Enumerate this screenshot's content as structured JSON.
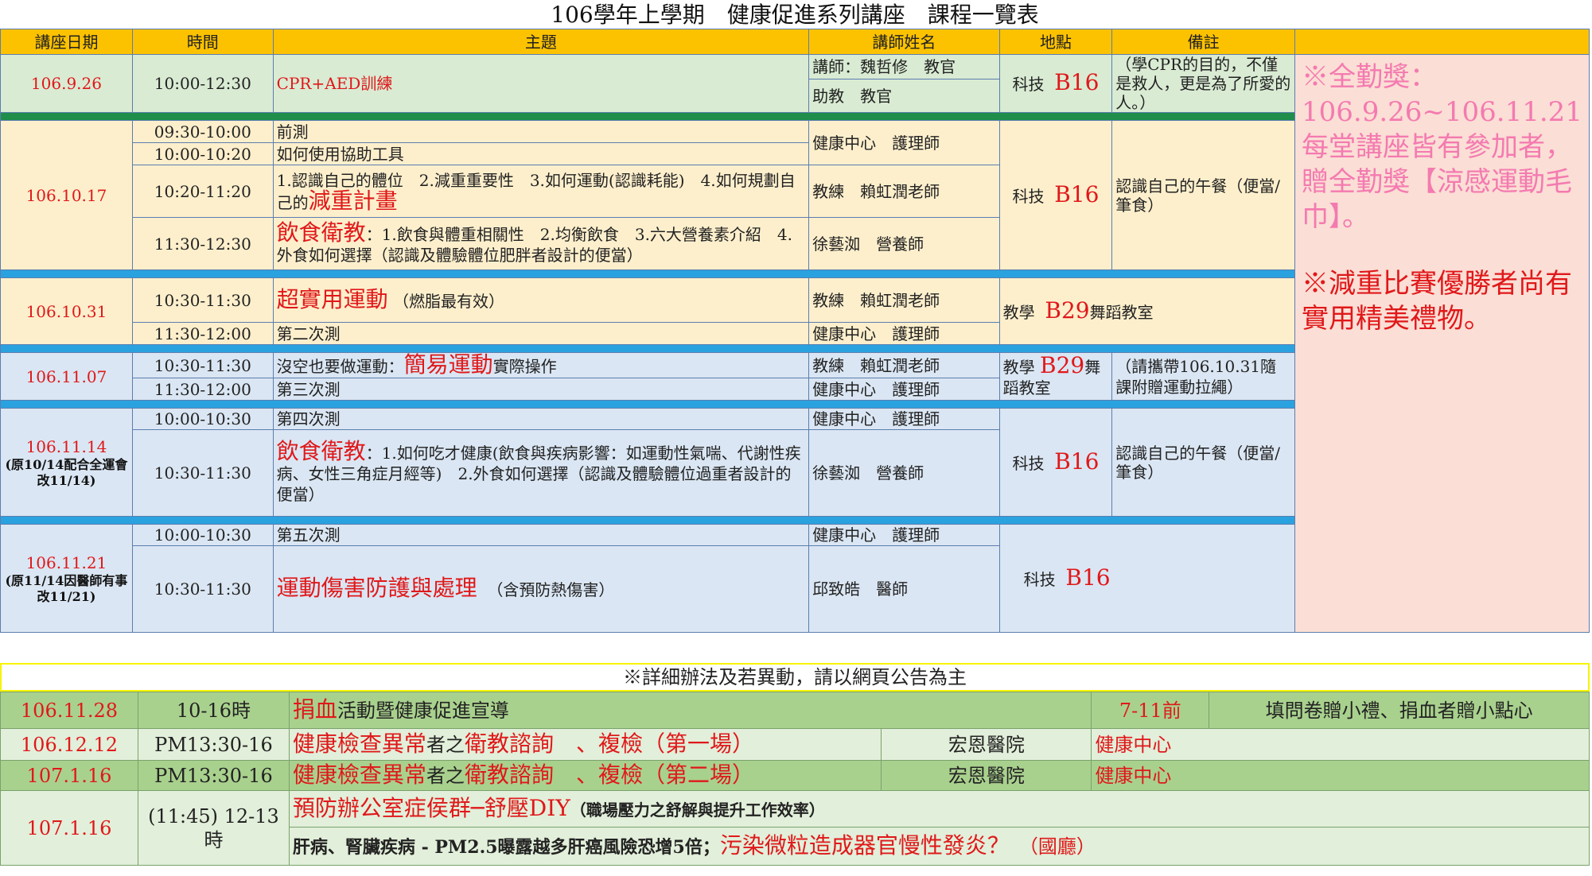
{
  "title": "106學年上學期　健康促進系列講座　課程一覽表",
  "headers": [
    "講座日期",
    "時間",
    "主題",
    "講師姓名",
    "地點",
    "備註"
  ],
  "s1": {
    "date": "106.9.26",
    "time": "10:00-12:30",
    "topic": "CPR+AED訓練",
    "lecturer1": "講師：魏哲修　教官",
    "lecturer2": "助教　教官",
    "loc_a": "科技",
    "loc_b": "B16",
    "note": "（學CPR的目的，不僅是救人，更是為了所愛的人。）"
  },
  "s2": {
    "date": "106.10.17",
    "r1_time": "09:30-10:00",
    "r1_topic": "前測",
    "r2_time": "10:00-10:20",
    "r2_topic": "如何使用協助工具",
    "lect_a": "健康中心　護理師",
    "r3_time": "10:20-11:20",
    "r3_topic": "1.認識自己的體位　2.減重重要性　3.如何運動(認識耗能)　4.如何規劃自己的",
    "r3_topic_red": "減重計畫",
    "lect_b": "教練　賴虹潤老師",
    "r4_time": "11:30-12:30",
    "r4_topic_red": "飲食衛教",
    "r4_topic": "：1.飲食與體重相關性　2.均衡飲食　3.六大營養素介紹　4.外食如何選擇（認識及體驗體位肥胖者設計的便當）",
    "lect_c": "徐藝洳　營養師",
    "loc_a": "科技",
    "loc_b": "B16",
    "note": "認識自己的午餐（便當/筆食）"
  },
  "s3": {
    "date": "106.10.31",
    "r1_time": "10:30-11:30",
    "r1_topic_red": "超實用運動",
    "r1_topic": "（燃脂最有效）",
    "lect_a": "教練　賴虹潤老師",
    "r2_time": "11:30-12:00",
    "r2_topic": "第二次測",
    "lect_b": "健康中心　護理師",
    "loc_a": "教學",
    "loc_b": "B29",
    "loc_c": "舞蹈教室"
  },
  "s4": {
    "date": "106.11.07",
    "r1_time": "10:30-11:30",
    "r1_topic": "沒空也要做運動：",
    "r1_topic_red": "簡易運動",
    "r1_topic2": "實際操作",
    "lect_a": "教練　賴虹潤老師",
    "r2_time": "11:30-12:00",
    "r2_topic": "第三次測",
    "lect_b": "健康中心　護理師",
    "loc_a": "教學",
    "loc_b": "B29",
    "loc_c": "舞蹈教室",
    "note": "（請攜帶106.10.31隨課附贈運動拉繩）"
  },
  "s5": {
    "date": "106.11.14",
    "date_note": "(原10/14配合全運會改11/14)",
    "r1_time": "10:00-10:30",
    "r1_topic": "第四次測",
    "lect_a": "健康中心　護理師",
    "r2_time": "10:30-11:30",
    "r2_topic_red": "飲食衛教",
    "r2_topic": "：1.如何吃才健康(飲食與疾病影響：如運動性氣喘、代謝性疾病、女性三角症月經等)　2.外食如何選擇（認識及體驗體位過重者設計的便當）",
    "lect_b": "徐藝洳　營養師",
    "loc_a": "科技",
    "loc_b": "B16",
    "note": "認識自己的午餐（便當/筆食）"
  },
  "s6": {
    "date": "106.11.21",
    "date_note": "(原11/14因醫師有事改11/21)",
    "r1_time": "10:00-10:30",
    "r1_topic": "第五次測",
    "lect_a": "健康中心　護理師",
    "r2_time": "10:30-11:30",
    "r2_topic_red": "運動傷害防護與處理",
    "r2_topic": "（含預防熱傷害）",
    "lect_b": "邱致皓　醫師",
    "loc_a": "科技",
    "loc_b": "B16"
  },
  "side": {
    "award1": "※全勤獎：106.9.26~106.11.21 每堂講座皆有參加者，贈全勤獎【涼感運動毛巾】。",
    "award2": "※減重比賽優勝者尚有實用精美禮物。"
  },
  "notice": "※詳細辦法及若異動，請以網頁公告為主",
  "bottom": {
    "b1": {
      "date": "106.11.28",
      "time": "10-16時",
      "topic_red": "捐血",
      "topic": "活動暨健康促進宣導",
      "loc": "7-11前",
      "note": "填問卷贈小禮、捐血者贈小點心"
    },
    "b2": {
      "date": "106.12.12",
      "time": "PM13:30-16",
      "topic_red1": "健康檢查異常",
      "topic_mid": "者之",
      "topic_red2": "衛教諮詢　、複檢（第一場）",
      "lecturer": "宏恩醫院",
      "loc": "健康中心"
    },
    "b3": {
      "date": "107.1.16",
      "time": "PM13:30-16",
      "topic_red1": "健康檢查異常",
      "topic_mid": "者之",
      "topic_red2": "衛教諮詢　、複檢（第二場）",
      "lecturer": "宏恩醫院",
      "loc": "健康中心"
    },
    "b4": {
      "date": "107.1.16",
      "time": "(11:45) 12-13時",
      "topic_red": "預防辦公室症侯群─舒壓DIY",
      "topic": "（職場壓力之舒解與提升工作效率）",
      "topic2": "肝病、腎臟疾病 - PM2.5曝露越多肝癌風險恐增5倍；",
      "topic2_red": "污染微粒造成器官慢性發炎？",
      "topic2_end": "　（國廳）"
    }
  }
}
